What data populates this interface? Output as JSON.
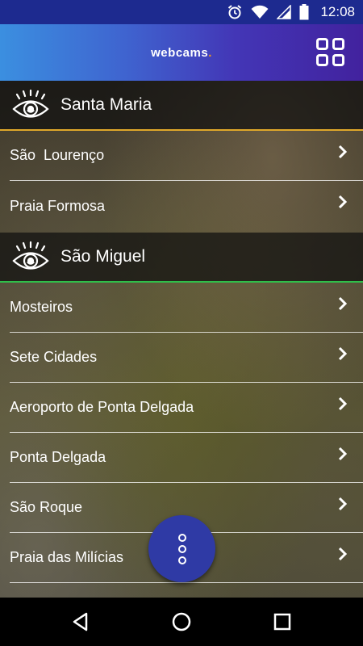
{
  "status_bar": {
    "time": "12:08",
    "icons": [
      "alarm-icon",
      "wifi-icon",
      "signal-icon",
      "battery-icon"
    ]
  },
  "app_bar": {
    "brand_text": "webcams",
    "brand_dot": ".",
    "accent_color": "#f39a1c",
    "menu_icon": "grid-icon"
  },
  "sections": [
    {
      "title": "Santa Maria",
      "divider_color": "#e0a82a",
      "items": [
        {
          "label": "São  Lourenço"
        },
        {
          "label": "Praia Formosa"
        }
      ]
    },
    {
      "title": "São Miguel",
      "divider_color": "#2fbf4a",
      "items": [
        {
          "label": "Mosteiros"
        },
        {
          "label": "Sete Cidades"
        },
        {
          "label": "Aeroporto de Ponta Delgada"
        },
        {
          "label": "Ponta Delgada"
        },
        {
          "label": "São Roque"
        },
        {
          "label": "Praia das Milícias"
        }
      ]
    }
  ],
  "fab": {
    "icon": "more-vertical-icon",
    "color": "#2f3aa5"
  },
  "nav_bar": {
    "icons": [
      "back-icon",
      "home-icon",
      "recents-icon"
    ]
  }
}
